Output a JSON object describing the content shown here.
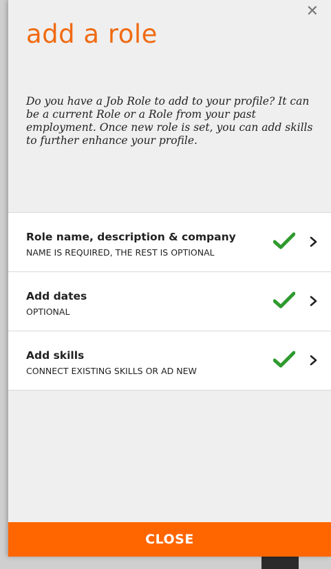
{
  "panel": {
    "title": "add a role",
    "close_icon_glyph": "✕",
    "intro": "Do you have a Job Role to add to your profile? It can be a current Role or a Role from your past employment. Once new role is set, you can add skills to further enhance your profile."
  },
  "steps": [
    {
      "title": "Role name, description & company",
      "subtitle": "NAME IS REQUIRED, THE REST IS OPTIONAL",
      "status_icon": "check-icon",
      "nav_icon": "chevron-right-icon"
    },
    {
      "title": "Add dates",
      "subtitle": "OPTIONAL",
      "status_icon": "check-icon",
      "nav_icon": "chevron-right-icon"
    },
    {
      "title": "Add skills",
      "subtitle": "CONNECT EXISTING SKILLS OR AD NEW",
      "status_icon": "check-icon",
      "nav_icon": "chevron-right-icon"
    }
  ],
  "footer": {
    "close_label": "CLOSE"
  },
  "colors": {
    "accent": "#ff6600",
    "title": "#f06a12",
    "check": "#2e9a2e"
  }
}
